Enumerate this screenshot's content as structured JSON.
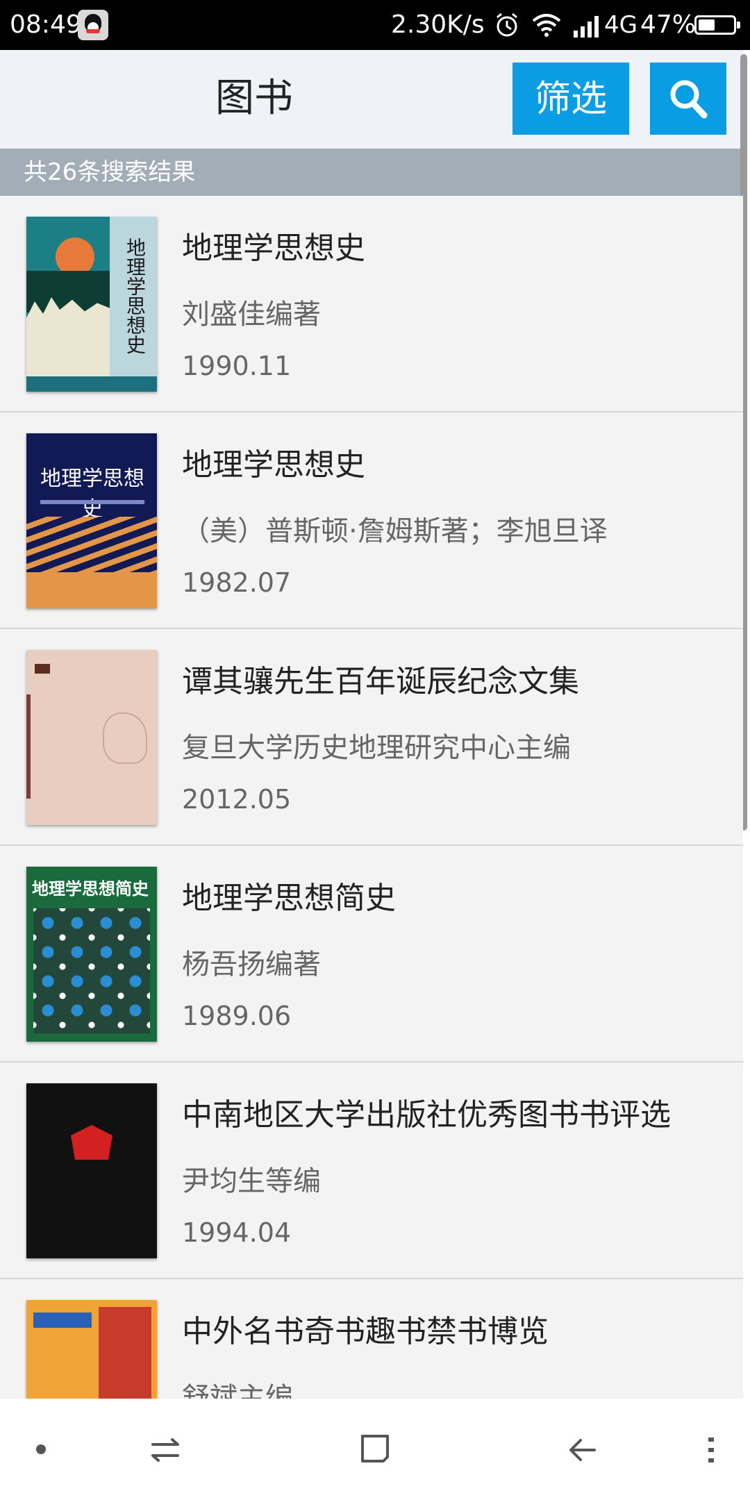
{
  "status_bar": {
    "time": "08:49",
    "network_speed": "2.30K/s",
    "network_type": "4G",
    "battery_percent": "47%",
    "battery_level": 0.47,
    "icons": [
      "qq-icon",
      "alarm-icon",
      "wifi-icon",
      "signal-icon",
      "battery-icon"
    ]
  },
  "app_bar": {
    "title": "图书",
    "filter_label": "筛选",
    "search_icon": "search-icon",
    "accent_color": "#0a9de4"
  },
  "results": {
    "summary": "共26条搜索结果"
  },
  "books": [
    {
      "title": "地理学思想史",
      "author": "刘盛佳编著",
      "date": "1990.11"
    },
    {
      "title": "地理学思想史",
      "author": "（美）普斯顿·詹姆斯著；李旭旦译",
      "date": "1982.07"
    },
    {
      "title": "谭其骧先生百年诞辰纪念文集",
      "author": "复旦大学历史地理研究中心主编",
      "date": "2012.05"
    },
    {
      "title": "地理学思想简史",
      "author": "杨吾扬编著",
      "date": "1989.06"
    },
    {
      "title": "中南地区大学出版社优秀图书书评选",
      "author": "尹均生等编",
      "date": "1994.04"
    },
    {
      "title": "中外名书奇书趣书禁书博览",
      "author": "舒斌主编",
      "date": ""
    }
  ],
  "nav_bar": {
    "icons": [
      "dot-icon",
      "switch-icon",
      "home-square-icon",
      "back-arrow-icon",
      "menu-dots-icon"
    ]
  }
}
